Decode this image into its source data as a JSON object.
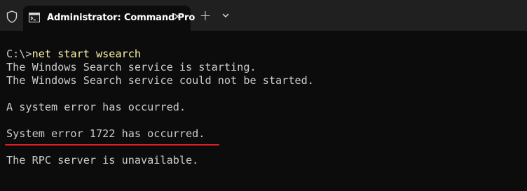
{
  "window": {
    "tab_title": "Administrator: Command Pro",
    "close_glyph": "✕",
    "new_tab_glyph": "+",
    "colors": {
      "titlebar": "#202020",
      "console_background": "#0c0c0c",
      "console_text": "#cccccc",
      "command_text": "#f9f1a5",
      "highlight_underline": "#e02020"
    }
  },
  "console": {
    "prompt": "C:\\>",
    "command": "net start wsearch",
    "lines": [
      "The Windows Search service is starting.",
      "The Windows Search service could not be started.",
      "",
      "A system error has occurred.",
      "",
      "System error 1722 has occurred.",
      "",
      "The RPC server is unavailable."
    ]
  },
  "icons": {
    "shield": "shield-icon",
    "cmd": "command-prompt-icon",
    "close": "close-icon",
    "new_tab": "plus-icon",
    "dropdown": "chevron-down-icon"
  }
}
